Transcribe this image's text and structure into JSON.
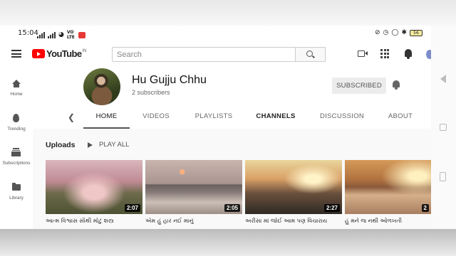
{
  "status": {
    "time": "15:04",
    "net_badge": "VO LTE",
    "battery": "56"
  },
  "masthead": {
    "logo_text": "YouTube",
    "logo_country": "IN",
    "search_placeholder": "Search"
  },
  "guide": {
    "items": [
      {
        "label": "Home",
        "icon": "home-icon"
      },
      {
        "label": "Trending",
        "icon": "flame-icon"
      },
      {
        "label": "Subscriptions",
        "icon": "subscriptions-icon"
      },
      {
        "label": "Library",
        "icon": "library-folder-icon"
      }
    ]
  },
  "channel": {
    "name": "Hu Gujju Chhu",
    "subscribers": "2 subscribers",
    "subscribe_label": "SUBSCRIBED",
    "tabs": [
      "HOME",
      "VIDEOS",
      "PLAYLISTS",
      "CHANNELS",
      "DISCUSSION",
      "ABOUT"
    ],
    "active_tab": "HOME"
  },
  "shelf": {
    "title": "Uploads",
    "play_all": "PLAY ALL"
  },
  "videos": [
    {
      "title": "આત્મ વિશ્વાસ સૌથી મોટું શસ્ત્ર",
      "duration": "2:07"
    },
    {
      "title": "એમ હું હાર નઈ માનું",
      "duration": "2:05"
    },
    {
      "title": "અરીસા માં જોઈ આમ પણ વિચારાય",
      "duration": "2:27"
    },
    {
      "title": "હું મને જ નથી ઓળખતી",
      "duration": "2"
    }
  ],
  "colors": {
    "brand_red": "#ff0000",
    "subscribed_bg": "#ececec"
  }
}
